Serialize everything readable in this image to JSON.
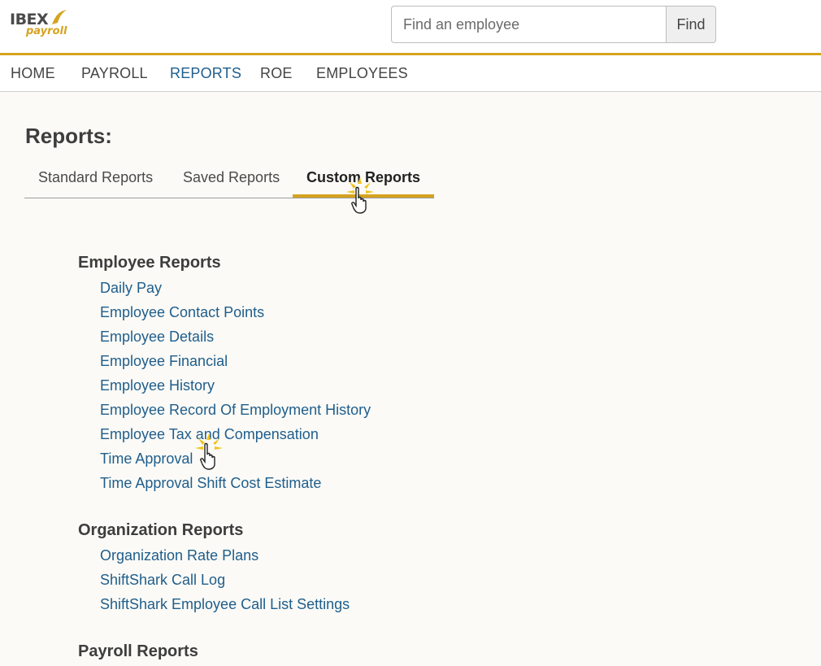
{
  "logo": {
    "brand": "IBEX",
    "product": "payroll"
  },
  "search": {
    "placeholder": "Find an employee",
    "button_label": "Find"
  },
  "nav": {
    "home": "HOME",
    "payroll": "PAYROLL",
    "reports": "REPORTS",
    "roe": "ROE",
    "employees": "EMPLOYEES",
    "active": "REPORTS"
  },
  "page": {
    "title": "Reports:"
  },
  "tabs": {
    "standard": "Standard Reports",
    "saved": "Saved Reports",
    "custom": "Custom Reports",
    "active": "Custom Reports"
  },
  "sections": {
    "employee": {
      "title": "Employee Reports",
      "links": [
        "Daily Pay",
        "Employee Contact Points",
        "Employee Details",
        "Employee Financial",
        "Employee History",
        "Employee Record Of Employment History",
        "Employee Tax and Compensation",
        "Time Approval",
        "Time Approval Shift Cost Estimate"
      ]
    },
    "organization": {
      "title": "Organization Reports",
      "links": [
        "Organization Rate Plans",
        "ShiftShark Call Log",
        "ShiftShark Employee Call List Settings"
      ]
    },
    "payroll": {
      "title": "Payroll Reports"
    }
  },
  "colors": {
    "accent": "#d6a31f",
    "link": "#1f5e8c",
    "background": "#fbfaf6"
  },
  "cursor_icon": "pointer-hand-click-icon"
}
